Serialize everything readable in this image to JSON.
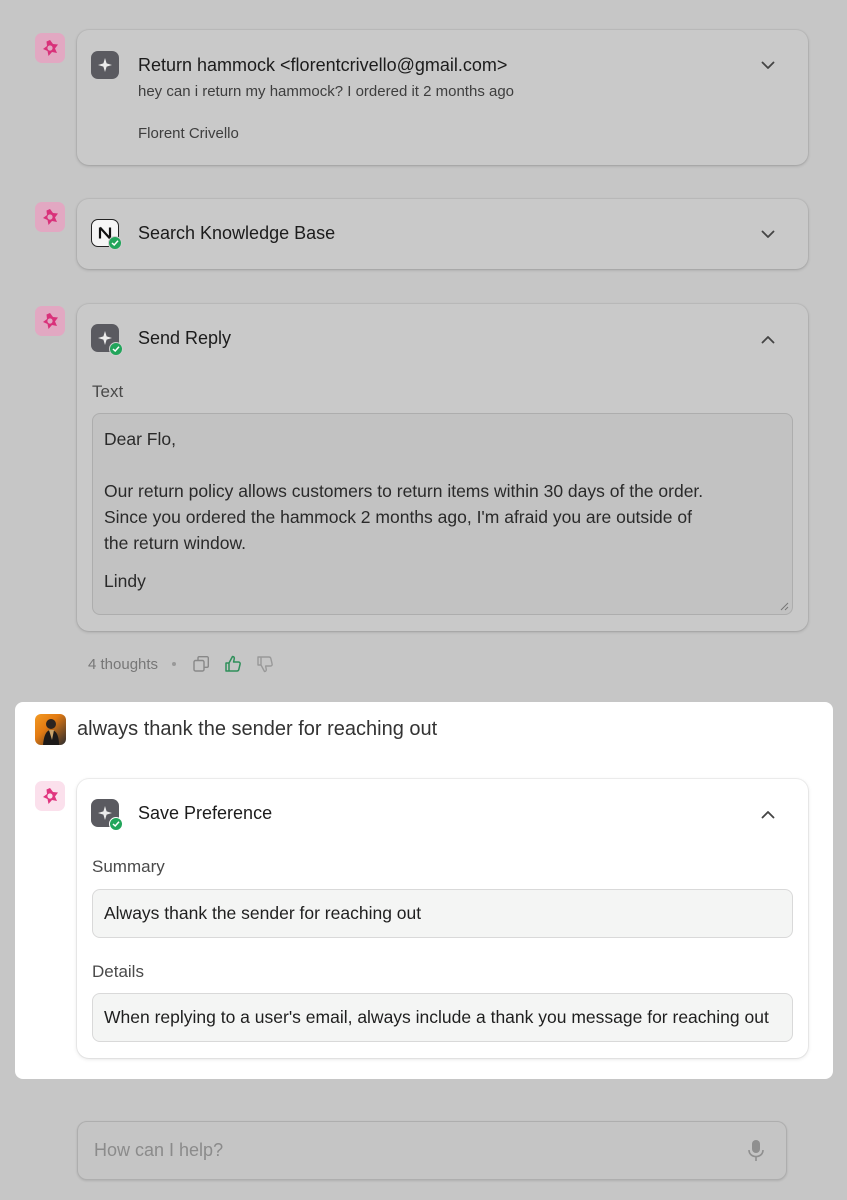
{
  "messages": [
    {
      "tool": "email",
      "title": "Return hammock <florentcrivello@gmail.com>",
      "snippet": "hey can i return my hammock? I ordered it 2 months ago",
      "sender": "Florent Crivello"
    },
    {
      "tool": "notion",
      "title": "Search Knowledge Base"
    },
    {
      "tool": "send-reply",
      "title": "Send Reply",
      "field_label": "Text",
      "text_lines": {
        "greeting": "Dear Flo,",
        "body_1": "Our return policy allows customers to return items within 30 days of the order.",
        "body_2": "Since you ordered the hammock 2 months ago, I'm afraid you are outside of",
        "body_3": "the return window.",
        "signoff": "Lindy"
      }
    }
  ],
  "thoughts": {
    "label": "4 thoughts"
  },
  "user_message": "always thank the sender for reaching out",
  "save_preference": {
    "title": "Save Preference",
    "summary_label": "Summary",
    "summary_value": "Always thank the sender for reaching out",
    "details_label": "Details",
    "details_value": "When replying to a user's email, always include a thank you message for reaching out"
  },
  "composer": {
    "placeholder": "How can I help?"
  },
  "colors": {
    "agent_accent": "#d9317a",
    "success": "#22a55b",
    "like_active": "#2f8f5a"
  }
}
